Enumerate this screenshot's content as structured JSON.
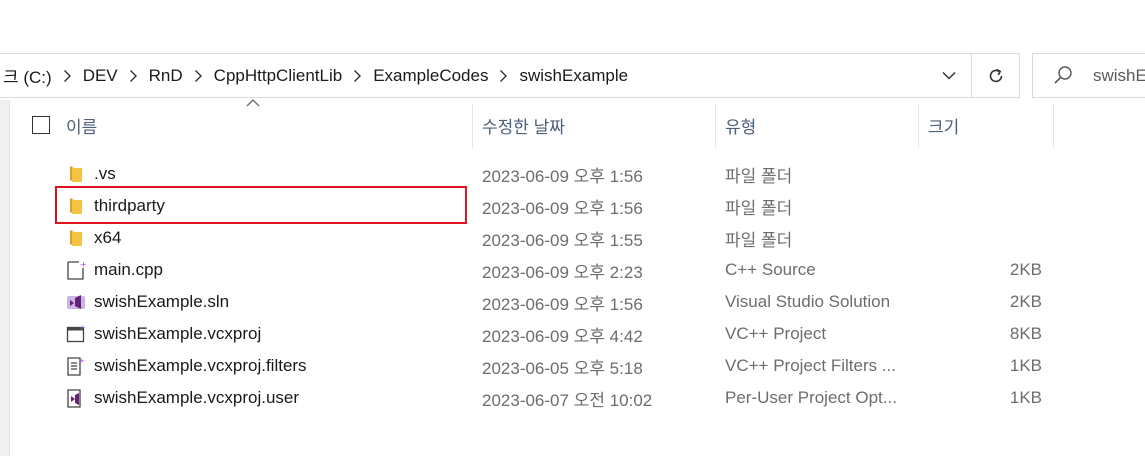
{
  "address_bar": {
    "crumbs": [
      "크 (C:)",
      "DEV",
      "RnD",
      "CppHttpClientLib",
      "ExampleCodes",
      "swishExample"
    ]
  },
  "search": {
    "placeholder": "swishE"
  },
  "columns": {
    "name": "이름",
    "date": "수정한 날짜",
    "type": "유형",
    "size": "크기"
  },
  "files": [
    {
      "icon": "folder-icon",
      "name": ".vs",
      "date": "2023-06-09 오후 1:56",
      "type": "파일 폴더",
      "size": ""
    },
    {
      "icon": "folder-icon",
      "name": "thirdparty",
      "date": "2023-06-09 오후 1:56",
      "type": "파일 폴더",
      "size": ""
    },
    {
      "icon": "folder-icon",
      "name": "x64",
      "date": "2023-06-09 오후 1:55",
      "type": "파일 폴더",
      "size": ""
    },
    {
      "icon": "cpp-file-icon",
      "name": "main.cpp",
      "date": "2023-06-09 오후 2:23",
      "type": "C++ Source",
      "size": "2KB"
    },
    {
      "icon": "visual-studio-solution-icon",
      "name": "swishExample.sln",
      "date": "2023-06-09 오후 1:56",
      "type": "Visual Studio Solution",
      "size": "2KB"
    },
    {
      "icon": "vcxproj-file-icon",
      "name": "swishExample.vcxproj",
      "date": "2023-06-09 오후 4:42",
      "type": "VC++ Project",
      "size": "8KB"
    },
    {
      "icon": "filters-file-icon",
      "name": "swishExample.vcxproj.filters",
      "date": "2023-06-05 오후 5:18",
      "type": "VC++ Project Filters ...",
      "size": "1KB"
    },
    {
      "icon": "user-file-icon",
      "name": "swishExample.vcxproj.user",
      "date": "2023-06-07 오전 10:02",
      "type": "Per-User Project Opt...",
      "size": "1KB"
    }
  ],
  "highlighted_item": "thirdparty",
  "colors": {
    "highlight_border": "#e0141e",
    "folder_yellow": "#f4c542",
    "vs_purple": "#68217a"
  }
}
